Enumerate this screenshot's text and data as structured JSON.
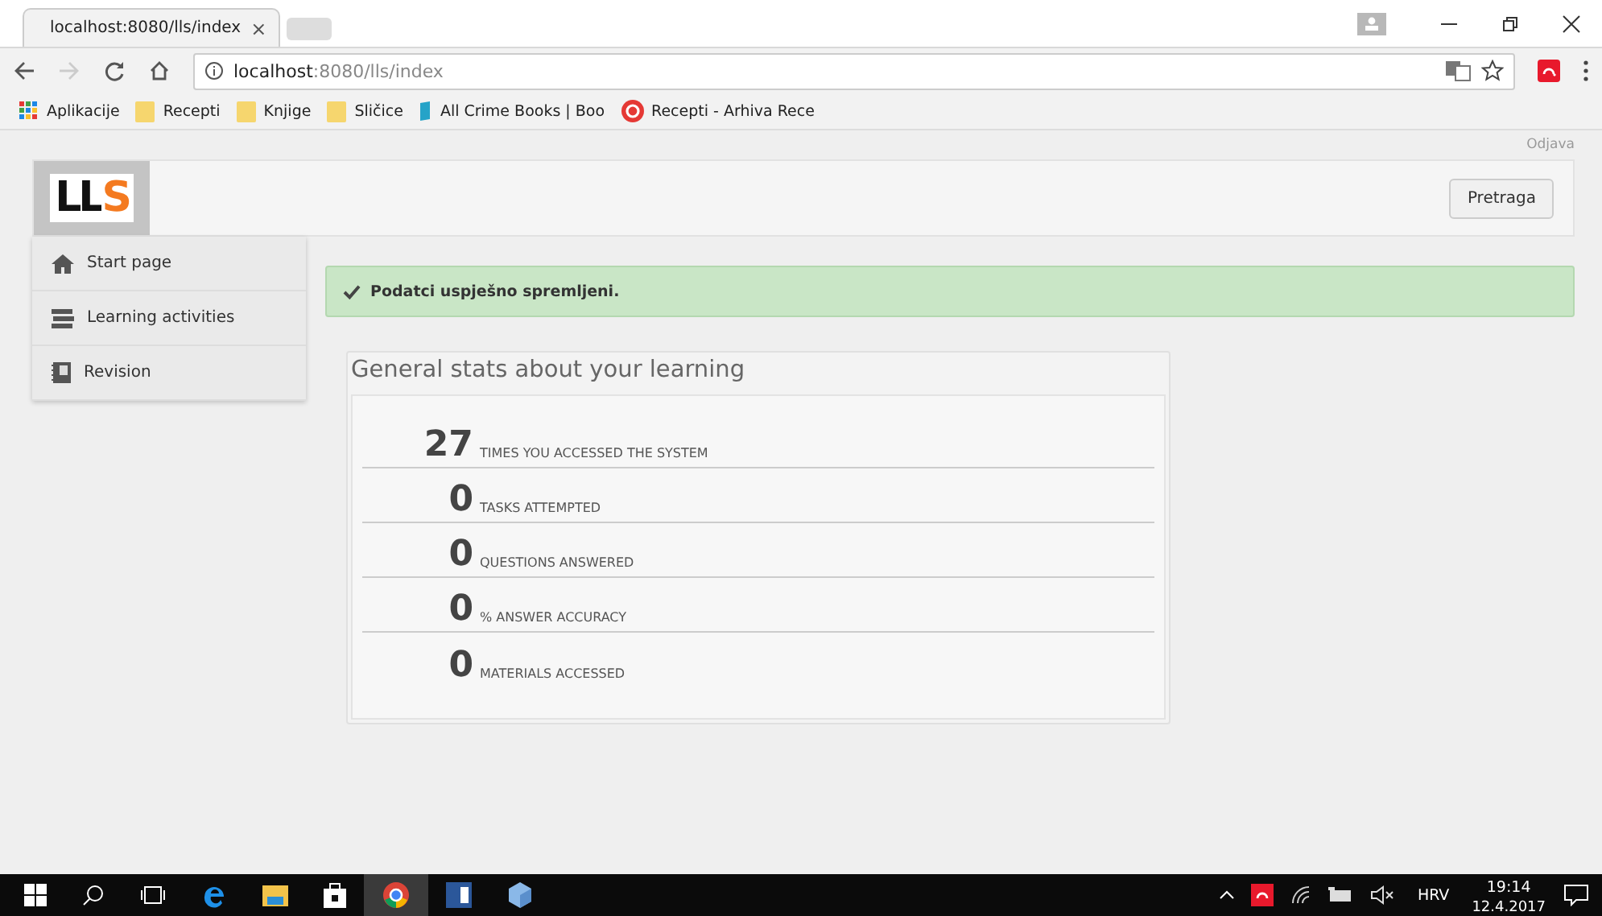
{
  "browser": {
    "tab": {
      "title": "localhost:8080/lls/index",
      "close": "×"
    },
    "address": {
      "host": "localhost",
      "rest": ":8080/lls/index"
    },
    "bookmarks": [
      {
        "kind": "apps",
        "label": "Aplikacije"
      },
      {
        "kind": "folder",
        "label": "Recepti"
      },
      {
        "kind": "folder",
        "label": "Knjige"
      },
      {
        "kind": "folder",
        "label": "Sličice"
      },
      {
        "kind": "book",
        "label": "All Crime Books | Boo"
      },
      {
        "kind": "site",
        "label": "Recepti - Arhiva Rece"
      }
    ]
  },
  "page": {
    "logout": "Odjava",
    "logo": {
      "main": "LL",
      "accent": "S"
    },
    "search_button": "Pretraga",
    "sidebar": {
      "items": [
        {
          "kind": "home",
          "label": "Start page"
        },
        {
          "kind": "books",
          "label": "Learning activities"
        },
        {
          "kind": "notebook",
          "label": "Revision"
        }
      ]
    },
    "alert": {
      "text": "Podatci uspješno spremljeni."
    },
    "stats": {
      "title": "General stats about your learning",
      "rows": [
        {
          "value": "27",
          "label": "TIMES YOU ACCESSED THE SYSTEM"
        },
        {
          "value": "0",
          "label": "TASKS ATTEMPTED"
        },
        {
          "value": "0",
          "label": "QUESTIONS ANSWERED"
        },
        {
          "value": "0",
          "label": "% ANSWER ACCURACY"
        },
        {
          "value": "0",
          "label": "MATERIALS ACCESSED"
        }
      ]
    }
  },
  "taskbar": {
    "language": "HRV",
    "time": "19:14",
    "date": "12.4.2017"
  }
}
